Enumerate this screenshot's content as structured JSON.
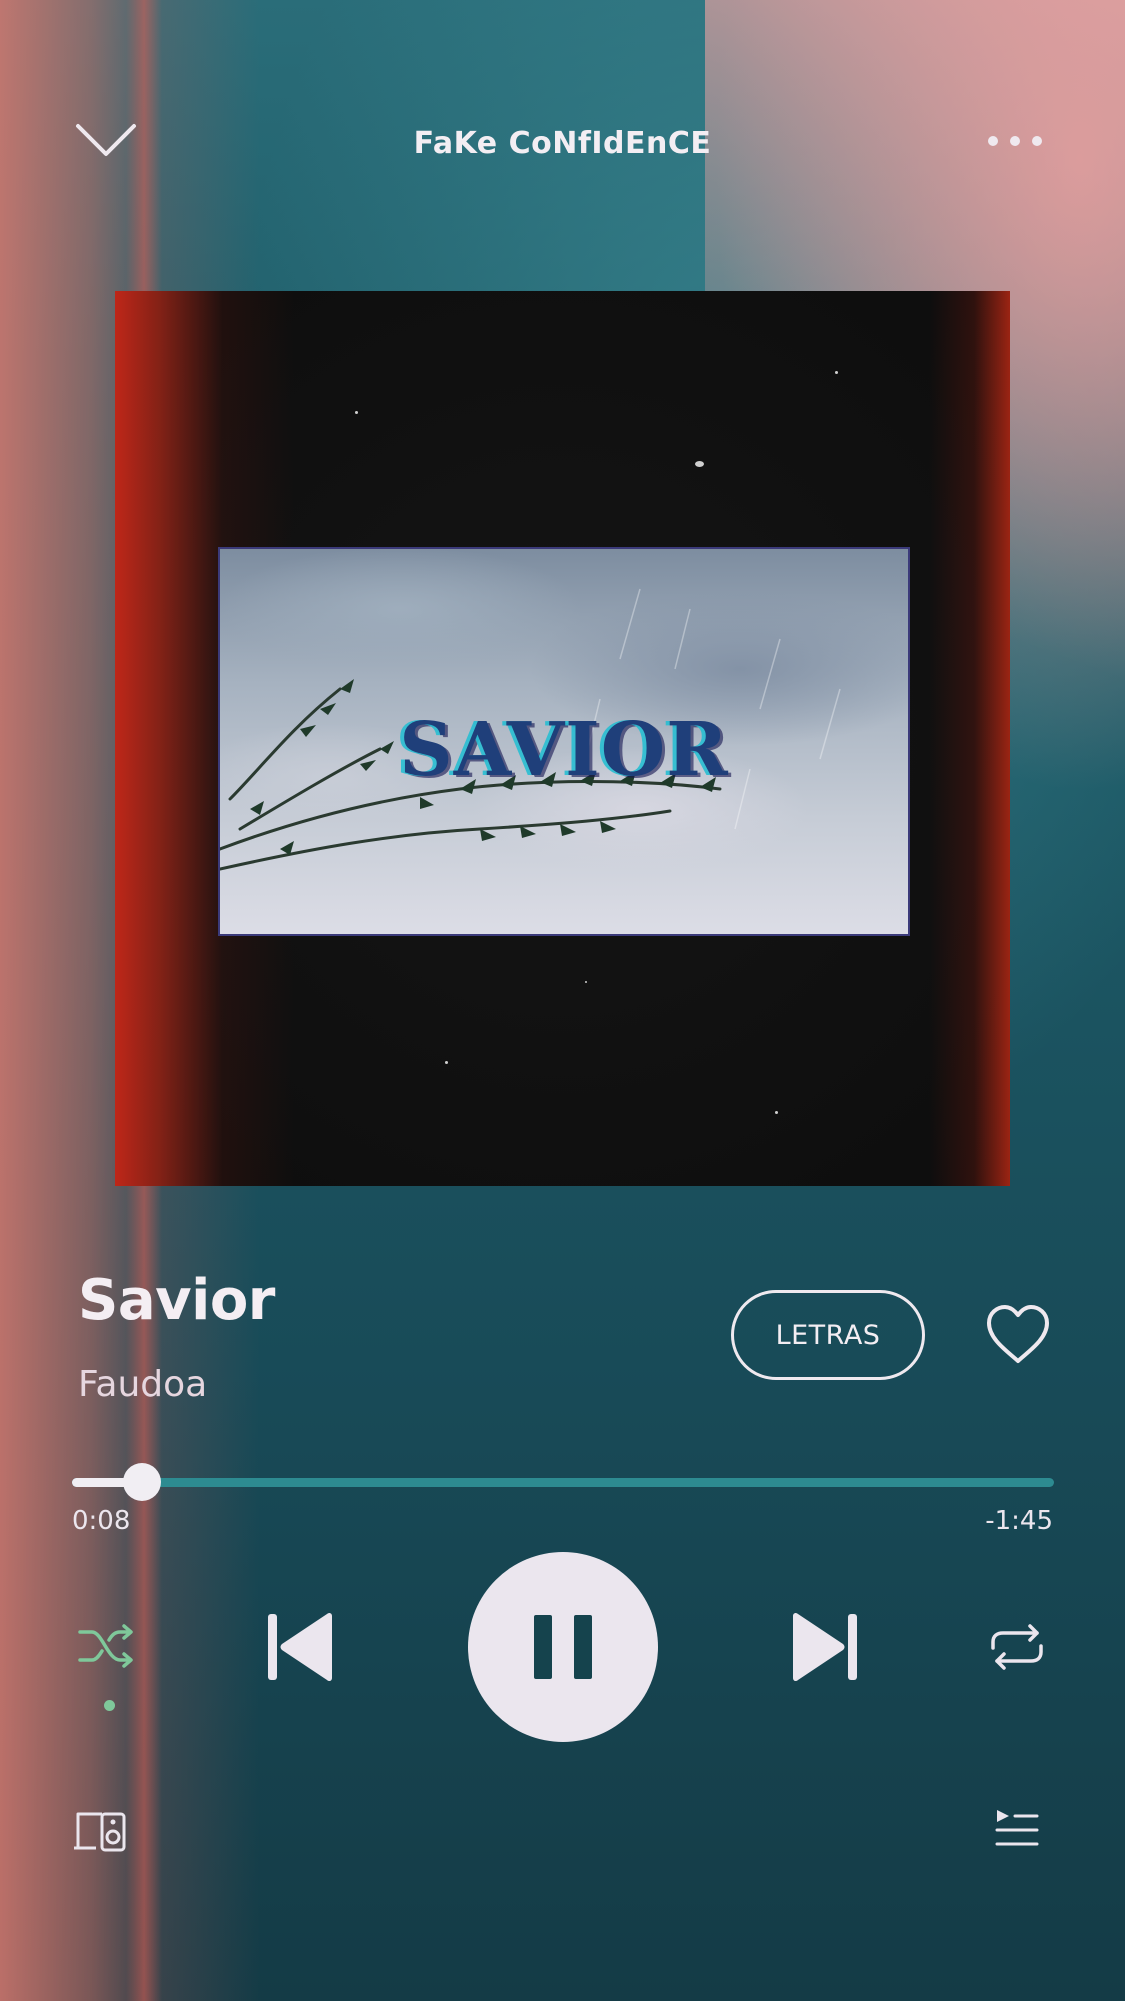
{
  "header": {
    "title": "FaKe CoNfIdEnCE"
  },
  "album_art": {
    "inner_text": "SAVIOR"
  },
  "track": {
    "title": "Savior",
    "artist": "Faudoa"
  },
  "lyrics_button": {
    "label": "LETRAS"
  },
  "progress": {
    "elapsed": "0:08",
    "remaining": "-1:45",
    "fraction": 0.071
  },
  "colors": {
    "accent_green": "#7fc89a",
    "progress_track": "#2d8b91",
    "foreground": "#ece6ee"
  },
  "icons": {
    "collapse": "chevron-down-icon",
    "more": "more-horizontal-icon",
    "like": "heart-icon",
    "shuffle": "shuffle-icon",
    "previous": "skip-previous-icon",
    "play_pause": "pause-icon",
    "next": "skip-next-icon",
    "repeat": "repeat-icon",
    "devices": "devices-icon",
    "queue": "queue-icon"
  }
}
